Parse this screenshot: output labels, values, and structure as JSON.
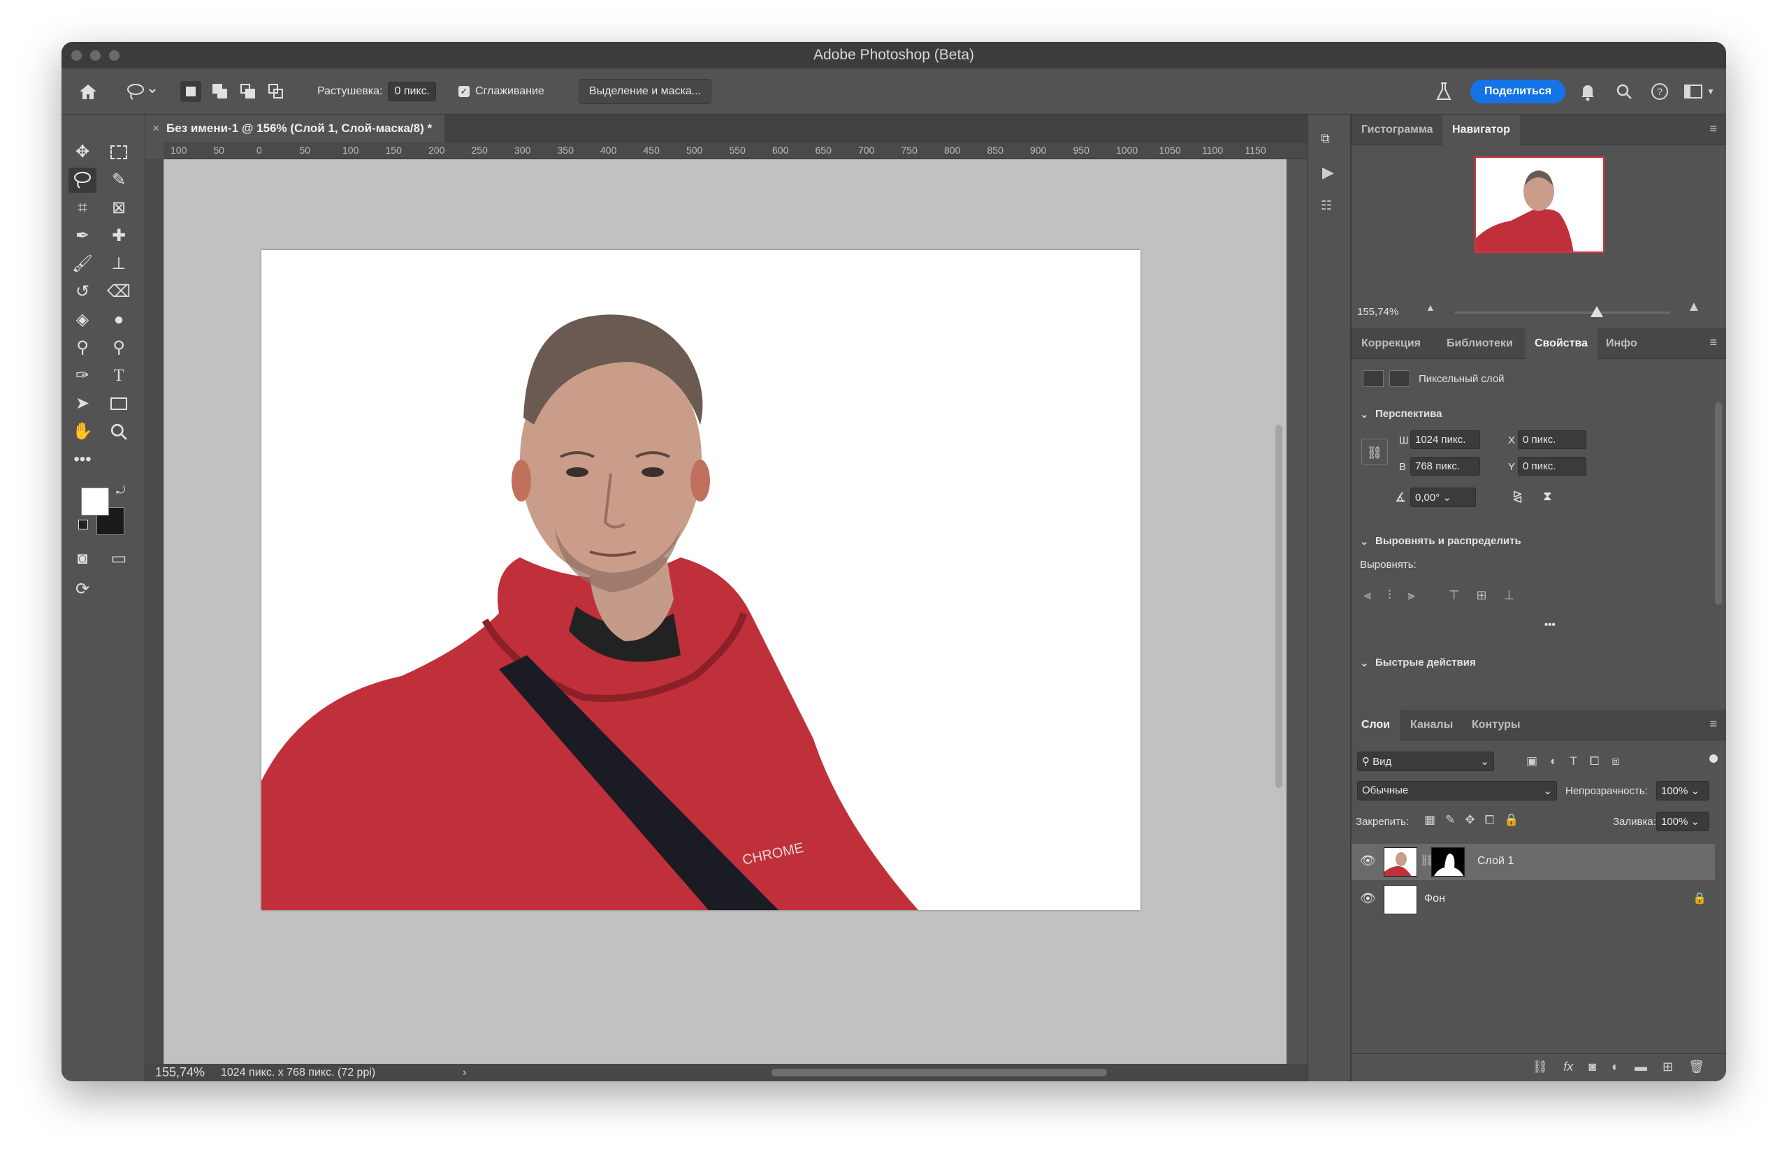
{
  "app": {
    "title": "Adobe Photoshop (Beta)"
  },
  "options": {
    "feather_label": "Растушевка:",
    "feather_value": "0 пикс.",
    "antialias_label": "Сглаживание",
    "select_mask_button": "Выделение и маска...",
    "share_button": "Поделиться"
  },
  "document": {
    "tab_title": "Без имени-1 @ 156% (Слой 1, Слой-маска/8) *",
    "zoom": "155,74%",
    "info": "1024 пикс. x 768 пикс. (72 ppi)",
    "logo_text": "CHROME"
  },
  "ruler": {
    "h_ticks": [
      "100",
      "50",
      "0",
      "50",
      "100",
      "150",
      "200",
      "250",
      "300",
      "350",
      "400",
      "450",
      "500",
      "550",
      "600",
      "650",
      "700",
      "750",
      "800",
      "850",
      "900",
      "950",
      "1000",
      "1050",
      "1100",
      "1150"
    ]
  },
  "navigator": {
    "tabs": [
      "Гистограмма",
      "Навигатор"
    ],
    "active_tab": "Навигатор",
    "zoom": "155,74%",
    "zoom_slider_level": 0.66
  },
  "properties": {
    "tabs": [
      "Коррекция",
      "Библиотеки",
      "Свойства",
      "Инфо"
    ],
    "active_tab": "Свойства",
    "layer_type": "Пиксельный слой",
    "perspective_title": "Перспектива",
    "w_label": "Ш",
    "w_value": "1024 пикс.",
    "h_label": "В",
    "h_value": "768 пикс.",
    "x_label": "X",
    "x_value": "0 пикс.",
    "y_label": "Y",
    "y_value": "0 пикс.",
    "angle_value": "0,00°",
    "align_title": "Выровнять и распределить",
    "align_label": "Выровнять:",
    "more": "•••",
    "quick_title": "Быстрые действия"
  },
  "layers": {
    "tabs": [
      "Слои",
      "Каналы",
      "Контуры"
    ],
    "active_tab": "Слои",
    "filter_label": "Вид",
    "blend_mode": "Обычные",
    "opacity_label": "Непрозрачность:",
    "opacity_value": "100%",
    "lock_label": "Закрепить:",
    "fill_label": "Заливка:",
    "fill_value": "100%",
    "items": [
      {
        "name": "Слой 1",
        "selected": true
      },
      {
        "name": "Фон",
        "selected": false
      }
    ],
    "footer_fx": "fx"
  },
  "colors": {
    "accent": "#1473e6",
    "foreground": "#ffffff",
    "background": "#1a1a1a",
    "hoodie": "#c0303a"
  }
}
